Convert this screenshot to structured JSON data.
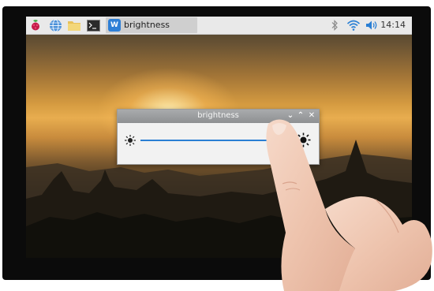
{
  "taskbar": {
    "active_task_label": "brightness",
    "clock": "14:14",
    "app_badge": "W"
  },
  "brightness_window": {
    "title": "brightness",
    "level": 0.92
  },
  "icons": [
    "raspberry-menu-icon",
    "web-browser-icon",
    "file-manager-icon",
    "terminal-icon",
    "bluetooth-icon",
    "wifi-icon",
    "volume-icon",
    "sun-dim-icon",
    "sun-bright-icon"
  ],
  "colors": {
    "taskbar_bg": "#e9e9e9",
    "slider_fill": "#2a7fd4",
    "titlebar": "#9a9c9e"
  }
}
